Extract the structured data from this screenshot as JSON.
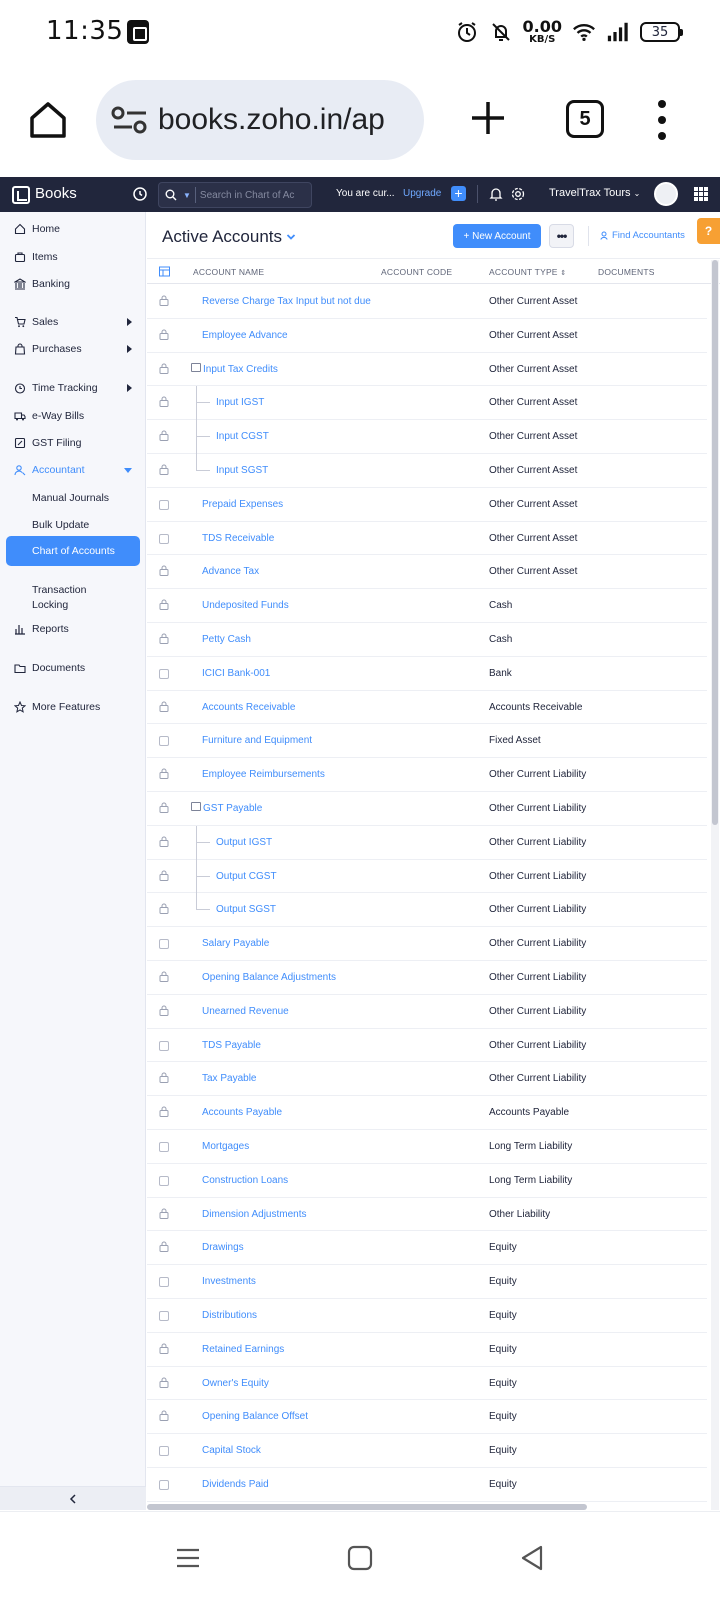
{
  "status_bar": {
    "time": "11:35",
    "net_speed_value": "0.00",
    "net_speed_unit": "KB/S",
    "battery": "35",
    "icons": [
      "alarm-icon",
      "mute-icon",
      "wifi-icon",
      "signal-icon",
      "battery-icon"
    ]
  },
  "browser": {
    "url": "books.zoho.in/ap",
    "tab_count": "5"
  },
  "appbar": {
    "brand": "Books",
    "search_placeholder": "Search in Chart of Ac",
    "notice": "You are cur...",
    "upgrade": "Upgrade",
    "add": "+",
    "org": "TravelTrax Tours"
  },
  "sidebar": {
    "items": [
      {
        "label": "Home",
        "icon": "home-icon"
      },
      {
        "label": "Items",
        "icon": "items-icon"
      },
      {
        "label": "Banking",
        "icon": "bank-icon"
      },
      {
        "label": "Sales",
        "icon": "cart-icon"
      },
      {
        "label": "Purchases",
        "icon": "bag-icon"
      },
      {
        "label": "Time Tracking",
        "icon": "clock-icon"
      },
      {
        "label": "e-Way Bills",
        "icon": "truck-icon"
      },
      {
        "label": "GST Filing",
        "icon": "gst-icon"
      },
      {
        "label": "Accountant",
        "icon": "accountant-icon"
      },
      {
        "label": "Reports",
        "icon": "reports-icon"
      },
      {
        "label": "Documents",
        "icon": "folder-icon"
      },
      {
        "label": "More Features",
        "icon": "star-icon"
      }
    ],
    "accountant_sub": [
      "Manual Journals",
      "Bulk Update",
      "Chart of Accounts",
      "Transaction",
      "Locking"
    ]
  },
  "main": {
    "title": "Active Accounts",
    "new_account": "+ New Account",
    "more": "•••",
    "find_accountants": "Find Accountants",
    "help": "?",
    "columns": [
      "ACCOUNT NAME",
      "ACCOUNT CODE",
      "ACCOUNT TYPE",
      "DOCUMENTS"
    ],
    "rows": [
      {
        "name": "Reverse Charge Tax Input but not due",
        "type": "Other Current Asset",
        "locked": true,
        "level": 0
      },
      {
        "name": "Employee Advance",
        "type": "Other Current Asset",
        "locked": true,
        "level": 0
      },
      {
        "name": "Input Tax Credits",
        "type": "Other Current Asset",
        "locked": true,
        "level": 0,
        "folder": true
      },
      {
        "name": "Input IGST",
        "type": "Other Current Asset",
        "locked": true,
        "level": 1
      },
      {
        "name": "Input CGST",
        "type": "Other Current Asset",
        "locked": true,
        "level": 1
      },
      {
        "name": "Input SGST",
        "type": "Other Current Asset",
        "locked": true,
        "level": 1
      },
      {
        "name": "Prepaid Expenses",
        "type": "Other Current Asset",
        "locked": false,
        "level": 0
      },
      {
        "name": "TDS Receivable",
        "type": "Other Current Asset",
        "locked": false,
        "level": 0
      },
      {
        "name": "Advance Tax",
        "type": "Other Current Asset",
        "locked": true,
        "level": 0
      },
      {
        "name": "Undeposited Funds",
        "type": "Cash",
        "locked": true,
        "level": 0
      },
      {
        "name": "Petty Cash",
        "type": "Cash",
        "locked": true,
        "level": 0
      },
      {
        "name": "ICICI Bank-001",
        "type": "Bank",
        "locked": false,
        "level": 0
      },
      {
        "name": "Accounts Receivable",
        "type": "Accounts Receivable",
        "locked": true,
        "level": 0
      },
      {
        "name": "Furniture and Equipment",
        "type": "Fixed Asset",
        "locked": false,
        "level": 0
      },
      {
        "name": "Employee Reimbursements",
        "type": "Other Current Liability",
        "locked": true,
        "level": 0
      },
      {
        "name": "GST Payable",
        "type": "Other Current Liability",
        "locked": true,
        "level": 0,
        "folder": true
      },
      {
        "name": "Output IGST",
        "type": "Other Current Liability",
        "locked": true,
        "level": 1
      },
      {
        "name": "Output CGST",
        "type": "Other Current Liability",
        "locked": true,
        "level": 1
      },
      {
        "name": "Output SGST",
        "type": "Other Current Liability",
        "locked": true,
        "level": 1
      },
      {
        "name": "Salary Payable",
        "type": "Other Current Liability",
        "locked": false,
        "level": 0
      },
      {
        "name": "Opening Balance Adjustments",
        "type": "Other Current Liability",
        "locked": true,
        "level": 0
      },
      {
        "name": "Unearned Revenue",
        "type": "Other Current Liability",
        "locked": true,
        "level": 0
      },
      {
        "name": "TDS Payable",
        "type": "Other Current Liability",
        "locked": false,
        "level": 0
      },
      {
        "name": "Tax Payable",
        "type": "Other Current Liability",
        "locked": true,
        "level": 0
      },
      {
        "name": "Accounts Payable",
        "type": "Accounts Payable",
        "locked": true,
        "level": 0
      },
      {
        "name": "Mortgages",
        "type": "Long Term Liability",
        "locked": false,
        "level": 0
      },
      {
        "name": "Construction Loans",
        "type": "Long Term Liability",
        "locked": false,
        "level": 0
      },
      {
        "name": "Dimension Adjustments",
        "type": "Other Liability",
        "locked": true,
        "level": 0
      },
      {
        "name": "Drawings",
        "type": "Equity",
        "locked": true,
        "level": 0
      },
      {
        "name": "Investments",
        "type": "Equity",
        "locked": false,
        "level": 0
      },
      {
        "name": "Distributions",
        "type": "Equity",
        "locked": false,
        "level": 0
      },
      {
        "name": "Retained Earnings",
        "type": "Equity",
        "locked": true,
        "level": 0
      },
      {
        "name": "Owner's Equity",
        "type": "Equity",
        "locked": true,
        "level": 0
      },
      {
        "name": "Opening Balance Offset",
        "type": "Equity",
        "locked": true,
        "level": 0
      },
      {
        "name": "Capital Stock",
        "type": "Equity",
        "locked": false,
        "level": 0
      },
      {
        "name": "Dividends Paid",
        "type": "Equity",
        "locked": false,
        "level": 0
      }
    ]
  },
  "colors": {
    "appbar_bg": "#21263c",
    "accent": "#408dfb",
    "help_orange": "#f7a033"
  }
}
